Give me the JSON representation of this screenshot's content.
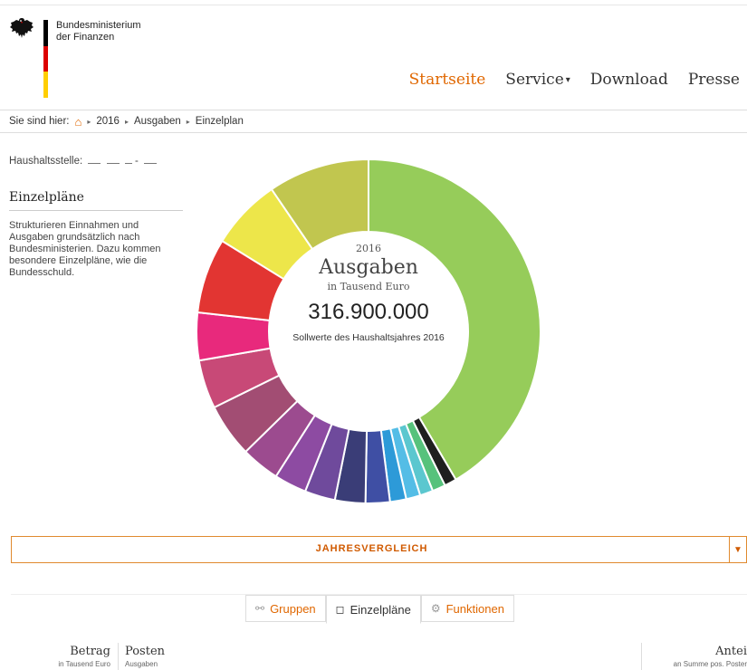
{
  "header": {
    "ministry_line1": "Bundesministerium",
    "ministry_line2": "der Finanzen",
    "flag_colors": [
      "#000000",
      "#dd0000",
      "#ffce00"
    ],
    "nav": [
      {
        "label": "Startseite",
        "active": true
      },
      {
        "label": "Service",
        "dropdown": true
      },
      {
        "label": "Download"
      },
      {
        "label": "Presse"
      }
    ],
    "accent_color": "#e06700"
  },
  "breadcrumb": {
    "prefix": "Sie sind hier:",
    "home_icon": "home-icon",
    "items": [
      "2016",
      "Ausgaben",
      "Einzelplan"
    ]
  },
  "sidebar": {
    "haushaltsstelle_label": "Haushaltsstelle:",
    "title": "Einzelpläne",
    "description": "Strukturieren Einnahmen und Ausgaben grundsätzlich nach Bundesministerien. Dazu kommen besondere Einzelpläne, wie die Bundesschuld."
  },
  "chart_center": {
    "year": "2016",
    "title": "Ausgaben",
    "unit": "in Tausend Euro",
    "total": "316.900.000",
    "note": "Sollwerte des Haushaltsjahres 2016"
  },
  "chart_data": {
    "type": "pie",
    "title": "Ausgaben",
    "total": 316900000,
    "values": [
      43.6,
      1.2,
      1.3,
      1.3,
      1.4,
      1.6,
      2.4,
      3.0,
      3.0,
      3.2,
      3.8,
      5.3,
      4.8,
      4.7,
      7.4,
      7.0,
      10.0
    ],
    "colors": [
      "#96cc5a",
      "#1f1f1f",
      "#57c27c",
      "#5bc7cf",
      "#54bde6",
      "#2d9ad8",
      "#3f4fa4",
      "#3a3d77",
      "#6f4a9c",
      "#8d4ba2",
      "#9c4b8f",
      "#a24d73",
      "#c84977",
      "#e8297c",
      "#e23532",
      "#ede64a",
      "#c1c64f"
    ]
  },
  "jahresvergleich": {
    "label": "JAHRESVERGLEICH"
  },
  "tabs": [
    {
      "label": "Gruppen",
      "icon": "group-icon",
      "active": false
    },
    {
      "label": "Einzelpläne",
      "icon": "square-icon",
      "active": true
    },
    {
      "label": "Funktionen",
      "icon": "gear-icon",
      "active": false
    }
  ],
  "table_header": {
    "amount": "Betrag",
    "amount_sub": "in Tausend Euro",
    "post": "Posten",
    "post_sub": "Ausgaben",
    "share": "Antei",
    "share_sub": "an Summe pos. Poster"
  }
}
